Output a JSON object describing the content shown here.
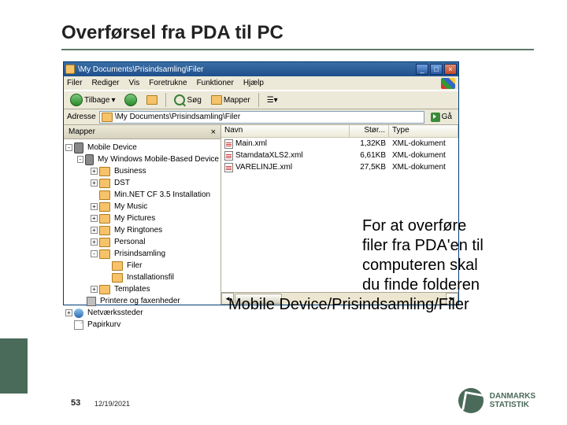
{
  "slide": {
    "title": "Overførsel fra PDA til PC",
    "body": "For at overføre filer fra PDA'en til computeren skal du finde folderen Mobile Device/Prisindsamling/Filer",
    "page_number": "53",
    "date": "12/19/2021"
  },
  "explorer": {
    "title": "\\My Documents\\Prisindsamling\\Filer",
    "minimize": "_",
    "maximize": "□",
    "close": "×",
    "menu": {
      "filer": "Filer",
      "rediger": "Rediger",
      "vis": "Vis",
      "foretrukne": "Foretrukne",
      "funktioner": "Funktioner",
      "hjaelp": "Hjælp"
    },
    "toolbar": {
      "tilbage": "Tilbage",
      "sog": "Søg",
      "mapper": "Mapper"
    },
    "address": {
      "label": "Adresse",
      "path": "\\My Documents\\Prisindsamling\\Filer",
      "go": "Gå"
    },
    "tree": {
      "header": "Mapper",
      "close": "×",
      "items": [
        {
          "indent": 0,
          "exp": "-",
          "icon": "pda",
          "label": "Mobile Device"
        },
        {
          "indent": 1,
          "exp": "-",
          "icon": "pda",
          "label": "My Windows Mobile-Based Device"
        },
        {
          "indent": 2,
          "exp": "+",
          "icon": "folder",
          "label": "Business"
        },
        {
          "indent": 2,
          "exp": "+",
          "icon": "folder",
          "label": "DST"
        },
        {
          "indent": 2,
          "exp": "",
          "icon": "folder",
          "label": "Min.NET CF 3.5 Installation"
        },
        {
          "indent": 2,
          "exp": "+",
          "icon": "folder",
          "label": "My Music"
        },
        {
          "indent": 2,
          "exp": "+",
          "icon": "folder",
          "label": "My Pictures"
        },
        {
          "indent": 2,
          "exp": "+",
          "icon": "folder",
          "label": "My Ringtones"
        },
        {
          "indent": 2,
          "exp": "+",
          "icon": "folder",
          "label": "Personal"
        },
        {
          "indent": 2,
          "exp": "-",
          "icon": "folder",
          "label": "Prisindsamling"
        },
        {
          "indent": 3,
          "exp": "",
          "icon": "folder",
          "label": "Filer"
        },
        {
          "indent": 3,
          "exp": "",
          "icon": "folder",
          "label": "Installationsfil"
        },
        {
          "indent": 2,
          "exp": "+",
          "icon": "folder",
          "label": "Templates"
        },
        {
          "indent": 1,
          "exp": "",
          "icon": "hand",
          "label": "Printere og faxenheder"
        },
        {
          "indent": 0,
          "exp": "+",
          "icon": "net",
          "label": "Netværkssteder"
        },
        {
          "indent": 0,
          "exp": "",
          "icon": "file",
          "label": "Papirkurv"
        }
      ]
    },
    "list": {
      "cols": {
        "name": "Navn",
        "size": "Stør...",
        "type": "Type"
      },
      "rows": [
        {
          "name": "Main.xml",
          "size": "1,32KB",
          "type": "XML-dokument"
        },
        {
          "name": "StamdataXLS2.xml",
          "size": "6,61KB",
          "type": "XML-dokument"
        },
        {
          "name": "VARELINJE.xml",
          "size": "27,5KB",
          "type": "XML-dokument"
        }
      ]
    }
  },
  "logo": {
    "line1": "DANMARKS",
    "line2": "STATISTIK"
  }
}
